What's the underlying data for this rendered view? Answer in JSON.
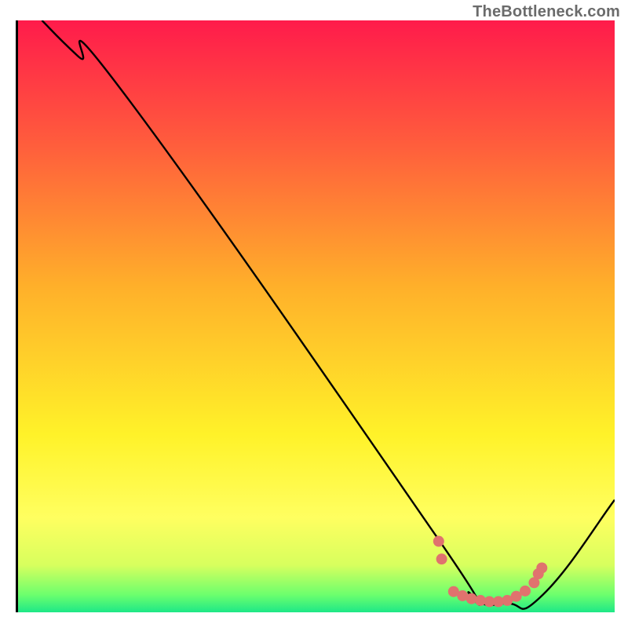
{
  "attribution": "TheBottleneck.com",
  "chart_data": {
    "type": "line",
    "title": "",
    "xlabel": "",
    "ylabel": "",
    "xlim": [
      0,
      100
    ],
    "ylim": [
      0,
      100
    ],
    "gradient_stops": [
      {
        "offset": 0,
        "color": "#ff1b4b"
      },
      {
        "offset": 20,
        "color": "#ff5a3d"
      },
      {
        "offset": 45,
        "color": "#ffb02a"
      },
      {
        "offset": 70,
        "color": "#fff229"
      },
      {
        "offset": 84,
        "color": "#ffff60"
      },
      {
        "offset": 92,
        "color": "#d8ff5e"
      },
      {
        "offset": 97,
        "color": "#6dff6d"
      },
      {
        "offset": 100,
        "color": "#1ee887"
      }
    ],
    "series": [
      {
        "name": "bottleneck-curve",
        "x": [
          4,
          10,
          19,
          70,
          76,
          82,
          88,
          100
        ],
        "y": [
          100,
          94,
          86,
          13,
          3,
          1.5,
          3,
          19
        ]
      }
    ],
    "scatter": {
      "name": "highlight-points",
      "color": "#e0726e",
      "radius": 7,
      "x": [
        70.5,
        71,
        73,
        74.5,
        76,
        77.5,
        79,
        80.5,
        82,
        83.5,
        85,
        86.5,
        87.2,
        87.8
      ],
      "y": [
        12,
        9,
        3.5,
        2.8,
        2.3,
        2.0,
        1.8,
        1.8,
        2.0,
        2.7,
        3.6,
        5.0,
        6.5,
        7.5
      ]
    }
  }
}
